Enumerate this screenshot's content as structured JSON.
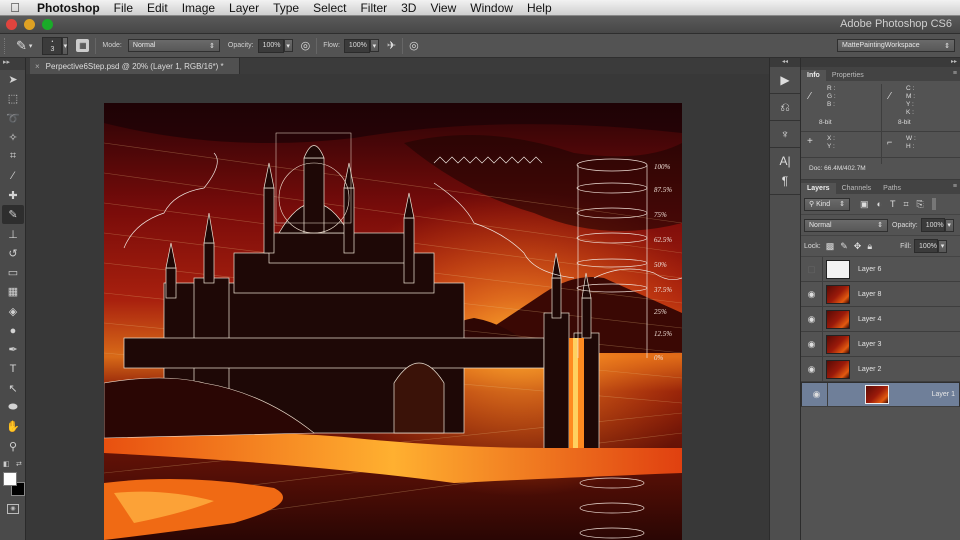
{
  "menubar": {
    "apple_icon": "",
    "app_name": "Photoshop",
    "items": [
      "File",
      "Edit",
      "Image",
      "Layer",
      "Type",
      "Select",
      "Filter",
      "3D",
      "View",
      "Window",
      "Help"
    ]
  },
  "window": {
    "title": "Adobe Photoshop CS6",
    "traffic_light_colors": [
      "#e0443e",
      "#dea123",
      "#1aab29"
    ]
  },
  "options_bar": {
    "brush_size": "3",
    "mode_label": "Mode:",
    "mode_value": "Normal",
    "opacity_label": "Opacity:",
    "opacity_value": "100%",
    "flow_label": "Flow:",
    "flow_value": "100%",
    "workspace": "MattePaintingWorkspace"
  },
  "document": {
    "tab_label": "Perpective6Step.psd @ 20% (Layer 1, RGB/16*) *",
    "close_glyph": "×",
    "zoom": "20%"
  },
  "canvas": {
    "percent_labels": [
      "100%",
      "87.5%",
      "75%",
      "62.5%",
      "50%",
      "37.5%",
      "25%",
      "12.5%",
      "0%"
    ]
  },
  "toolbox": {
    "tools": [
      {
        "name": "move-tool",
        "glyph": "➤"
      },
      {
        "name": "marquee-tool",
        "glyph": "⬚"
      },
      {
        "name": "lasso-tool",
        "glyph": "➰"
      },
      {
        "name": "quick-selection-tool",
        "glyph": "✧"
      },
      {
        "name": "crop-tool",
        "glyph": "⌗"
      },
      {
        "name": "eyedropper-tool",
        "glyph": "⁄"
      },
      {
        "name": "healing-brush-tool",
        "glyph": "✚"
      },
      {
        "name": "brush-tool",
        "glyph": "✎"
      },
      {
        "name": "clone-stamp-tool",
        "glyph": "⊥"
      },
      {
        "name": "history-brush-tool",
        "glyph": "↺"
      },
      {
        "name": "eraser-tool",
        "glyph": "▭"
      },
      {
        "name": "gradient-tool",
        "glyph": "▦"
      },
      {
        "name": "blur-tool",
        "glyph": "◈"
      },
      {
        "name": "dodge-tool",
        "glyph": "●"
      },
      {
        "name": "pen-tool",
        "glyph": "✒"
      },
      {
        "name": "type-tool",
        "glyph": "T"
      },
      {
        "name": "path-selection-tool",
        "glyph": "↖"
      },
      {
        "name": "ellipse-tool",
        "glyph": "⬬"
      },
      {
        "name": "hand-tool",
        "glyph": "✋"
      },
      {
        "name": "zoom-tool",
        "glyph": "⚲"
      }
    ],
    "active_tool": "brush-tool",
    "foreground_color": "#ffffff",
    "background_color": "#000000"
  },
  "dock": {
    "collapse_glyph": "◂◂",
    "buttons": [
      {
        "name": "actions",
        "glyph": "▶"
      },
      {
        "name": "history",
        "glyph": "⎌"
      },
      {
        "name": "brush-presets",
        "glyph": "♆"
      },
      {
        "name": "character",
        "glyph": "A|"
      },
      {
        "name": "paragraph",
        "glyph": "¶"
      }
    ]
  },
  "info_panel": {
    "tabs": [
      "Info",
      "Properties"
    ],
    "active_tab": "Info",
    "rgb_labels": [
      "R :",
      "G :",
      "B :"
    ],
    "cmyk_labels": [
      "C :",
      "M :",
      "Y :",
      "K :"
    ],
    "bit_depth_left": "8-bit",
    "bit_depth_right": "8-bit",
    "xy_labels": [
      "X :",
      "Y :"
    ],
    "wh_labels": [
      "W :",
      "H :"
    ],
    "doc_size": "Doc: 66.4M/402.7M"
  },
  "layers_panel": {
    "tabs": [
      "Layers",
      "Channels",
      "Paths"
    ],
    "active_tab": "Layers",
    "filter_kind": "Kind",
    "blend_mode": "Normal",
    "opacity_label": "Opacity:",
    "opacity_value": "100%",
    "lock_label": "Lock:",
    "fill_label": "Fill:",
    "fill_value": "100%",
    "layers": [
      {
        "name": "Layer 6",
        "visible": false,
        "thumb": "white",
        "selected": false
      },
      {
        "name": "Layer 8",
        "visible": true,
        "thumb": "scene",
        "selected": false
      },
      {
        "name": "Layer 4",
        "visible": true,
        "thumb": "scene",
        "selected": false
      },
      {
        "name": "Layer 3",
        "visible": true,
        "thumb": "scene",
        "selected": false
      },
      {
        "name": "Layer 2",
        "visible": true,
        "thumb": "scene",
        "selected": false
      },
      {
        "name": "Layer 1",
        "visible": true,
        "thumb": "scene",
        "selected": true
      }
    ]
  }
}
